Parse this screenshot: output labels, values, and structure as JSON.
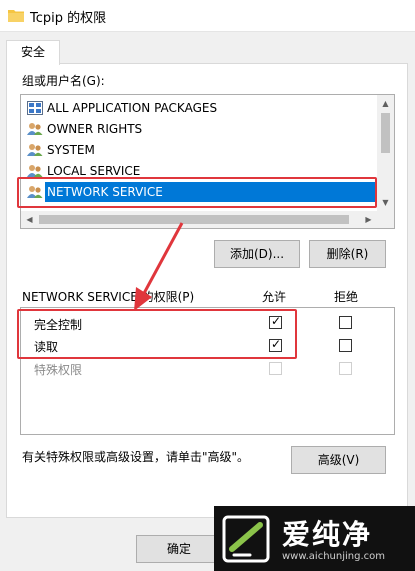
{
  "window": {
    "title": "Tcpip 的权限"
  },
  "tabs": [
    {
      "label": "安全"
    }
  ],
  "groups": {
    "label": "组或用户名(G):",
    "items": [
      {
        "name": "ALL APPLICATION PACKAGES",
        "icon": "package-icon"
      },
      {
        "name": "OWNER RIGHTS",
        "icon": "users-icon"
      },
      {
        "name": "SYSTEM",
        "icon": "users-icon"
      },
      {
        "name": "LOCAL SERVICE",
        "icon": "users-icon"
      },
      {
        "name": "NETWORK SERVICE",
        "icon": "users-icon",
        "selected": true
      }
    ]
  },
  "buttons": {
    "add": "添加(D)...",
    "remove": "删除(R)",
    "advanced": "高级(V)",
    "ok": "确定"
  },
  "permissions": {
    "title": "NETWORK SERVICE 的权限(P)",
    "allow_header": "允许",
    "deny_header": "拒绝",
    "rows": [
      {
        "name": "完全控制",
        "allow": true,
        "deny": false,
        "disabled": false
      },
      {
        "name": "读取",
        "allow": true,
        "deny": false,
        "disabled": false
      },
      {
        "name": "特殊权限",
        "allow": false,
        "deny": false,
        "disabled": true
      }
    ]
  },
  "special_note": "有关特殊权限或高级设置，请单击\"高级\"。",
  "watermark": {
    "brand": "爱纯净",
    "url": "www.aichunjing.com"
  },
  "colors": {
    "selection": "#0078d7",
    "annotation": "#e0363c",
    "folder": "#f5c542"
  }
}
